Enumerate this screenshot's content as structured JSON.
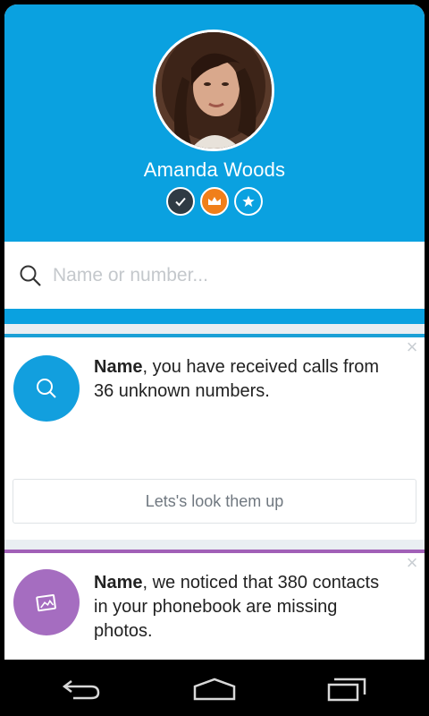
{
  "profile": {
    "name": "Amanda Woods",
    "badges": [
      "check-badge",
      "crown-badge",
      "star-badge"
    ]
  },
  "search": {
    "placeholder": "Name or number...",
    "value": ""
  },
  "cards": [
    {
      "icon": "search-icon",
      "accent": "#1aa0d6",
      "bold": "Name",
      "message": ", you have received calls from 36 unknown numbers.",
      "action_label": "Lets's look them up"
    },
    {
      "icon": "image-icon",
      "accent": "#a160b7",
      "bold": "Name",
      "message": ", we noticed that 380 contacts in your phonebook are missing photos."
    }
  ],
  "nav": [
    "back-icon",
    "home-icon",
    "recent-apps-icon"
  ],
  "colors": {
    "header": "#0aa1e0",
    "crown": "#f07f1a",
    "dark_badge": "#2f3b44",
    "purple": "#a56dc0"
  }
}
